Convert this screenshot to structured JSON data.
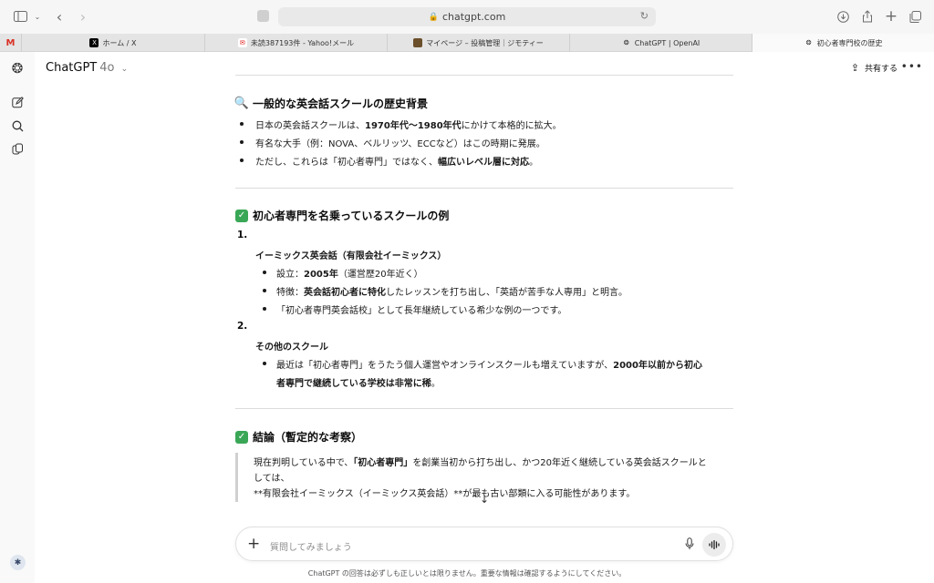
{
  "browser": {
    "url": "chatgpt.com",
    "tabs": [
      {
        "label": "",
        "icon": "gmail-icon"
      },
      {
        "label": "ホーム / X",
        "icon": "x-icon"
      },
      {
        "label": "未読387193件 - Yahoo!メール",
        "icon": "yahoo-mail-icon"
      },
      {
        "label": "マイページ – 投稿管理｜ジモティー",
        "icon": "jmty-icon"
      },
      {
        "label": "ChatGPT | OpenAI",
        "icon": "openai-icon"
      },
      {
        "label": "初心者専門校の歴史",
        "icon": "openai-icon"
      }
    ]
  },
  "topbar": {
    "model_name": "ChatGPT",
    "model_version": "4o",
    "share_label": "共有する"
  },
  "message": {
    "section1": {
      "heading": "一般的な英会話スクールの歴史背景",
      "bullets": [
        {
          "pre": "日本の英会話スクールは、",
          "bold": "1970年代〜1980年代",
          "post": "にかけて本格的に拡大。"
        },
        {
          "pre": "有名な大手（例：NOVA、ベルリッツ、ECCなど）はこの時期に発展。",
          "bold": "",
          "post": ""
        },
        {
          "pre": "ただし、これらは「初心者専門」ではなく、",
          "bold": "幅広いレベル層に対応",
          "post": "。"
        }
      ]
    },
    "section2": {
      "heading": "初心者専門を名乗っているスクールの例",
      "item1": {
        "number": "1.",
        "title": "イーミックス英会話（有限会社イーミックス）",
        "bullets": [
          {
            "pre": "設立：",
            "bold": "2005年",
            "post": "（運営歴20年近く）"
          },
          {
            "pre": "特徴：",
            "bold": "英会話初心者に特化",
            "post": "したレッスンを打ち出し、「英語が苦手な人専用」と明言。"
          },
          {
            "pre": "「初心者専門英会話校」として長年継続している希少な例の一つです。",
            "bold": "",
            "post": ""
          }
        ]
      },
      "item2": {
        "number": "2.",
        "title": "その他のスクール",
        "bullet_line1_pre": "最近は「初心者専門」をうたう個人運営やオンラインスクールも増えていますが、",
        "bullet_line1_bold": "2000年以前から初心",
        "bullet_line2_bold": "者専門で継続している学校は非常に稀",
        "bullet_line2_post": "。"
      }
    },
    "section3": {
      "heading": "結論（暫定的な考察）",
      "quote_line1_pre": "現在判明している中で、",
      "quote_line1_bold": "「初心者専門」",
      "quote_line1_post": "を創業当初から打ち出し、かつ20年近く継続している英会話スクールと",
      "quote_line2": "しては、",
      "quote_line3": "**有限会社イーミックス（イーミックス英会話）**が最も古い部類に入る可能性があります。"
    }
  },
  "composer": {
    "placeholder": "質問してみましょう"
  },
  "footer": {
    "disclaimer": "ChatGPT の回答は必ずしも正しいとは限りません。重要な情報は確認するようにしてください。"
  }
}
